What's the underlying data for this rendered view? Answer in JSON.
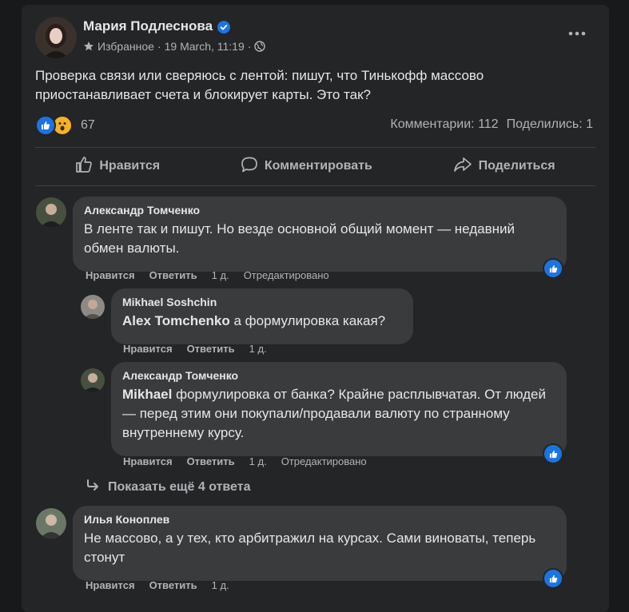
{
  "post": {
    "author": "Мария Подлеснова",
    "audience": "Избранное",
    "separator": "·",
    "date": "19 March, 11:19",
    "text": "Проверка связи или сверяюсь с лентой: пишут, что Тинькофф массово приостанавливает счета и блокирует карты. Это так?",
    "reaction_count": "67",
    "comments_count": "Комментарии: 112",
    "shares_count": "Поделились: 1"
  },
  "actions": {
    "like": "Нравится",
    "comment": "Комментировать",
    "share": "Поделиться"
  },
  "comments": [
    {
      "author": "Александр Томченко",
      "text": "В ленте так и пишут. Но везде основной общий момент — недавний обмен валюты.",
      "like": "Нравится",
      "reply": "Ответить",
      "time": "1 д.",
      "edited": "Отредактировано"
    },
    {
      "author": "Mikhael Soshchin",
      "mention": "Alex Tomchenko",
      "text": " а формулировка какая?",
      "like": "Нравится",
      "reply": "Ответить",
      "time": "1 д."
    },
    {
      "author": "Александр Томченко",
      "mention": "Mikhael",
      "text": " формулировка от банка? Крайне расплывчатая. От людей — перед этим они покупали/продавали валюту по странному внутреннему курсу.",
      "like": "Нравится",
      "reply": "Ответить",
      "time": "1 д.",
      "edited": "Отредактировано"
    },
    {
      "author": "Илья Коноплев",
      "text": "Не массово, а у тех, кто арбитражил на курсах. Сами виноваты, теперь стонут",
      "like": "Нравится",
      "reply": "Ответить",
      "time": "1 д."
    }
  ],
  "show_more_replies": "Показать ещё 4 ответа",
  "colors": {
    "background": "#18191a",
    "card": "#242526",
    "bubble": "#3a3b3c",
    "accent": "#1b74e4",
    "text": "#e4e6eb",
    "secondary": "#b0b3b8"
  },
  "icons": [
    "verified-badge-icon",
    "star-icon",
    "globe-icon",
    "more-icon",
    "like-reaction-icon",
    "wow-reaction-icon",
    "thumbs-up-icon",
    "comment-icon",
    "share-icon",
    "reply-arrow-icon"
  ]
}
